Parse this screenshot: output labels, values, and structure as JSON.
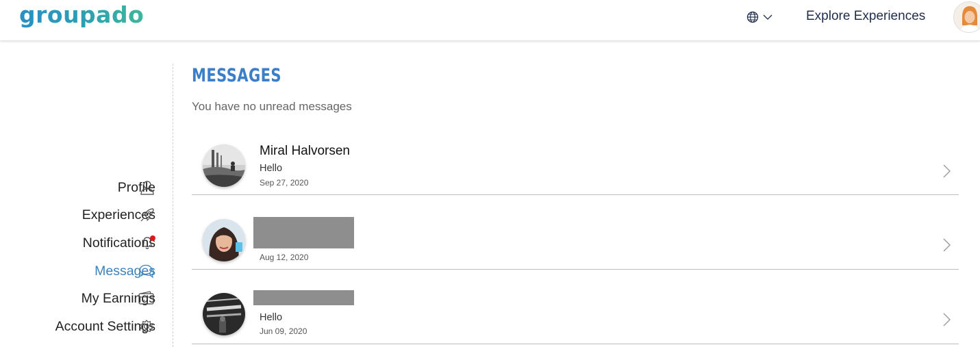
{
  "header": {
    "logo": "groupado",
    "explore_label": "Explore Experiences",
    "language_icon": "globe-icon",
    "brand_colors": [
      "#2a8fc4",
      "#3bb89a"
    ]
  },
  "sidebar": {
    "active_color": "#3b82bf",
    "items": [
      {
        "label": "Profile",
        "icon": "user-icon"
      },
      {
        "label": "Experiences",
        "icon": "rocket-icon"
      },
      {
        "label": "Notifications",
        "icon": "bell-icon",
        "has_badge": true
      },
      {
        "label": "Messages",
        "icon": "chat-icon",
        "active": true
      },
      {
        "label": "My Earnings",
        "icon": "wallet-icon"
      },
      {
        "label": "Account Settings",
        "icon": "gear-icon"
      }
    ]
  },
  "main": {
    "title": "MESSAGES",
    "subtitle": "You have no unread messages",
    "title_color": "#3a7fc8",
    "conversations": [
      {
        "name": "Miral Halvorsen",
        "preview": "Hello",
        "date": "Sep 27, 2020",
        "name_redacted": false
      },
      {
        "name": "",
        "preview": "",
        "date": "Aug 12, 2020",
        "name_redacted": true
      },
      {
        "name": "",
        "preview": "Hello",
        "date": "Jun 09, 2020",
        "name_redacted": true
      }
    ]
  }
}
